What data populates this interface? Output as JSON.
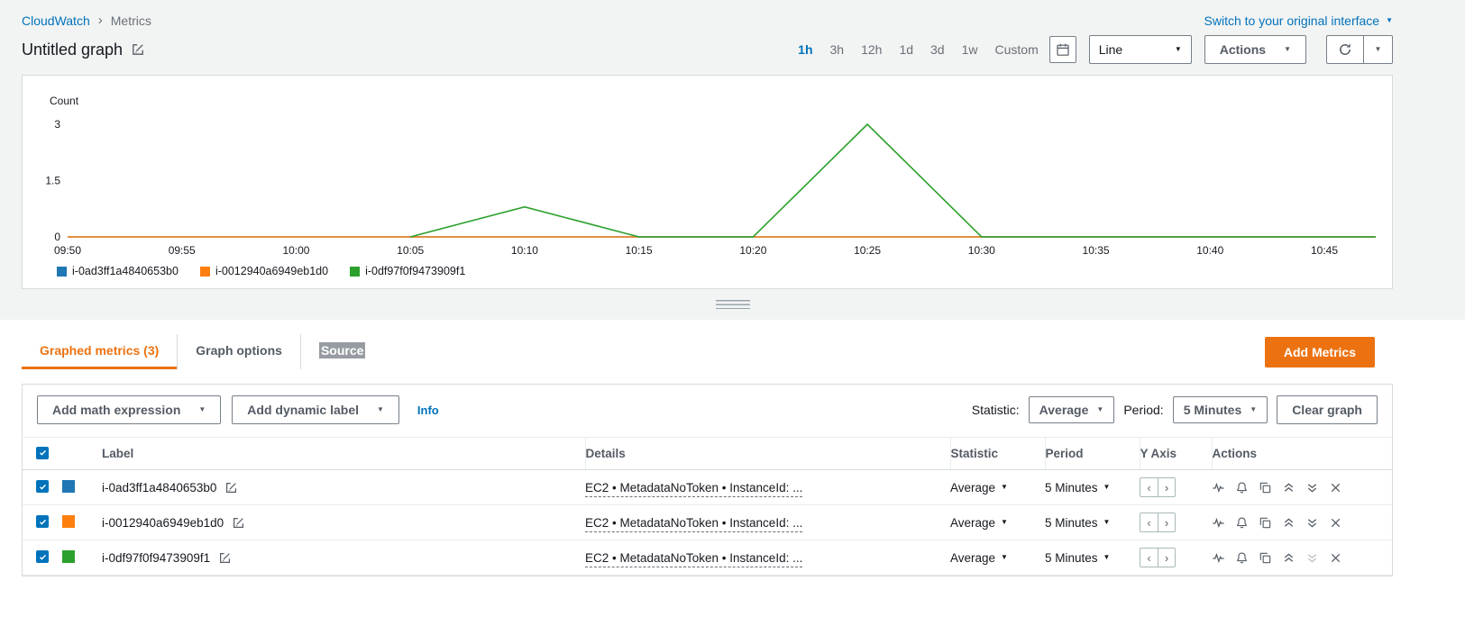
{
  "breadcrumb": {
    "items": [
      "CloudWatch",
      "Metrics"
    ]
  },
  "header": {
    "switch_link": "Switch to your original interface",
    "title": "Untitled graph"
  },
  "toolbar": {
    "time_ranges": [
      "1h",
      "3h",
      "12h",
      "1d",
      "3d",
      "1w",
      "Custom"
    ],
    "active_range": "1h",
    "chart_type_value": "Line",
    "actions_label": "Actions"
  },
  "chart_data": {
    "type": "line",
    "title": "",
    "ylabel": "Count",
    "yticks": [
      0,
      1.5,
      3
    ],
    "ylim": [
      0,
      3
    ],
    "x": [
      "09:50",
      "09:55",
      "10:00",
      "10:05",
      "10:10",
      "10:15",
      "10:20",
      "10:25",
      "10:30",
      "10:35",
      "10:40",
      "10:45"
    ],
    "grid": false,
    "legend_position": "bottom-left",
    "series": [
      {
        "name": "i-0ad3ff1a4840653b0",
        "color": "#1f77b4",
        "values": [
          0,
          0,
          0,
          0,
          0,
          0,
          0,
          0,
          0,
          0,
          0,
          0
        ]
      },
      {
        "name": "i-0012940a6949eb1d0",
        "color": "#ff7f0e",
        "values": [
          0,
          0,
          0,
          0,
          0,
          0,
          0,
          0,
          0,
          0,
          0,
          0
        ]
      },
      {
        "name": "i-0df97f0f9473909f1",
        "color": "#2ca02c",
        "values": [
          null,
          null,
          null,
          0,
          0.8,
          0,
          0,
          3,
          0,
          0,
          0,
          0
        ]
      }
    ]
  },
  "tabs": {
    "items": [
      {
        "label": "Graphed metrics (3)",
        "state": "active"
      },
      {
        "label": "Graph options",
        "state": "normal"
      },
      {
        "label": "Source",
        "state": "selected-text"
      }
    ],
    "add_metrics_label": "Add Metrics"
  },
  "metrics_toolbar": {
    "add_math_label": "Add math expression",
    "add_dynamic_label": "Add dynamic label",
    "info_label": "Info",
    "statistic_label": "Statistic:",
    "statistic_value": "Average",
    "period_label": "Period:",
    "period_value": "5 Minutes",
    "clear_graph_label": "Clear graph"
  },
  "table": {
    "columns": [
      "Label",
      "Details",
      "Statistic",
      "Period",
      "Y Axis",
      "Actions"
    ],
    "rows": [
      {
        "checked": true,
        "color": "#1f77b4",
        "label": "i-0ad3ff1a4840653b0",
        "details": "EC2 • MetadataNoToken • InstanceId: ...",
        "statistic": "Average",
        "period": "5 Minutes",
        "move_up_enabled": true,
        "move_down_enabled": true
      },
      {
        "checked": true,
        "color": "#ff7f0e",
        "label": "i-0012940a6949eb1d0",
        "details": "EC2 • MetadataNoToken • InstanceId: ...",
        "statistic": "Average",
        "period": "5 Minutes",
        "move_up_enabled": true,
        "move_down_enabled": true
      },
      {
        "checked": true,
        "color": "#2ca02c",
        "label": "i-0df97f0f9473909f1",
        "details": "EC2 • MetadataNoToken • InstanceId: ...",
        "statistic": "Average",
        "period": "5 Minutes",
        "move_up_enabled": true,
        "move_down_enabled": false
      }
    ]
  },
  "colors": {
    "accent_orange": "#ec7211",
    "link_blue": "#0073bb",
    "text_dark": "#16191f",
    "text_gray": "#545b64",
    "border": "#d5dbdb"
  }
}
